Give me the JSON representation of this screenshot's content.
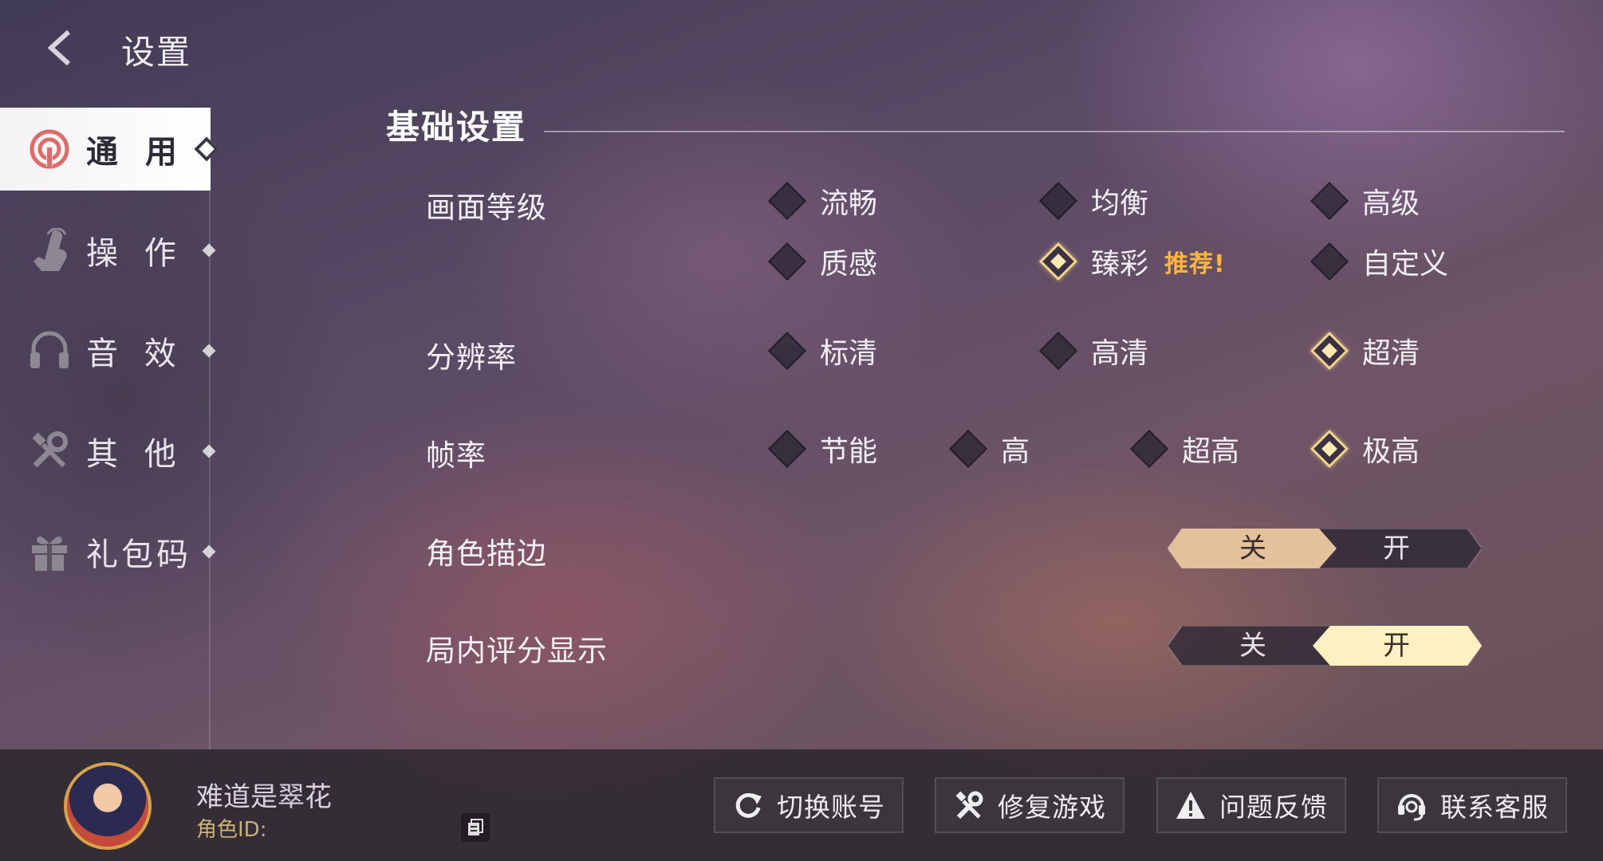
{
  "header": {
    "title": "设置",
    "back_icon": "chevron-left-icon"
  },
  "sidebar": {
    "items": [
      {
        "label": "通 用",
        "icon": "general-icon",
        "active": true
      },
      {
        "label": "操 作",
        "icon": "tap-hand-icon",
        "active": false
      },
      {
        "label": "音 效",
        "icon": "headphones-icon",
        "active": false
      },
      {
        "label": "其 他",
        "icon": "tools-icon",
        "active": false
      },
      {
        "label": "礼包码",
        "icon": "gift-icon",
        "active": false
      }
    ]
  },
  "section": {
    "title": "基础设置"
  },
  "settings": {
    "quality": {
      "label": "画面等级",
      "options": [
        "流畅",
        "均衡",
        "高级",
        "质感",
        "臻彩",
        "自定义"
      ],
      "selected": "臻彩",
      "recommend": "推荐!"
    },
    "resolution": {
      "label": "分辨率",
      "options": [
        "标清",
        "高清",
        "超清"
      ],
      "selected": "超清"
    },
    "framerate": {
      "label": "帧率",
      "options": [
        "节能",
        "高",
        "超高",
        "极高"
      ],
      "selected": "极高"
    },
    "outline": {
      "label": "角色描边",
      "off": "关",
      "on": "开",
      "value": "关"
    },
    "score": {
      "label": "局内评分显示",
      "off": "关",
      "on": "开",
      "value": "开"
    }
  },
  "footer": {
    "player_name": "难道是翠花",
    "role_id_label": "角色ID:",
    "buttons": [
      {
        "label": "切换账号",
        "icon": "refresh-icon"
      },
      {
        "label": "修复游戏",
        "icon": "wrench-icon"
      },
      {
        "label": "问题反馈",
        "icon": "warning-icon"
      },
      {
        "label": "联系客服",
        "icon": "headset-icon"
      }
    ]
  },
  "colors": {
    "accent": "#f0d48a",
    "recommend": "#ffb53d",
    "toggle_on": "#fff0c2",
    "toggle_off_active": "#e3c19a"
  }
}
